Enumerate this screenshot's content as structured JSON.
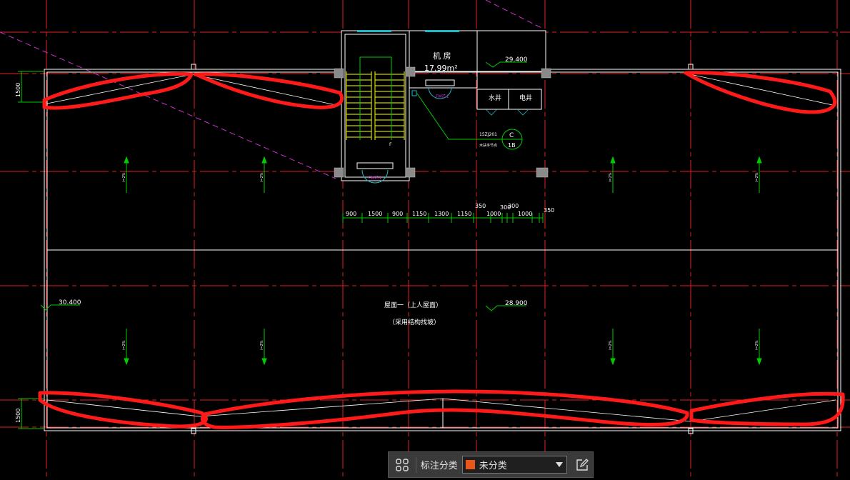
{
  "drawing": {
    "room_machine": "机 房",
    "room_machine_area": "17.99m²",
    "elev_top": "29.400",
    "elev_left": "30.400",
    "elev_mid": "28.900",
    "water_well": "水井",
    "elec_well": "电井",
    "door_tag_1": "FM乙1",
    "door_tag_2": "FM乙1",
    "stair_mark": "F",
    "ref_code": "15ZJ201",
    "ref_note": "木扶手节点",
    "detail_top": "C",
    "detail_bottom": "1B",
    "dim_1500_top": "1500",
    "dim_1500_bottom": "1500",
    "roof_title": "屋面一（上人屋面）",
    "roof_note": "（采用结构找坡）",
    "slope_label": "i=2%",
    "dims": [
      "900",
      "1500",
      "900",
      "1150",
      "1300",
      "1150",
      "1000",
      "300",
      "1000"
    ],
    "dim_350_a": "350",
    "dim_350_b": "350",
    "dim_300_b": "300"
  },
  "toolbar": {
    "grid_icon": "grid-icon",
    "label": "标注分类",
    "selected": "未分类",
    "swatch_color": "#e8561a",
    "edit_icon": "edit-icon"
  },
  "colors": {
    "background": "#000000",
    "axis": "#ff2020",
    "outline": "#ffffff",
    "dim": "#00ff00",
    "stair": "#ffff00",
    "annotation": "#ff0000",
    "magenta": "#cc33cc"
  }
}
